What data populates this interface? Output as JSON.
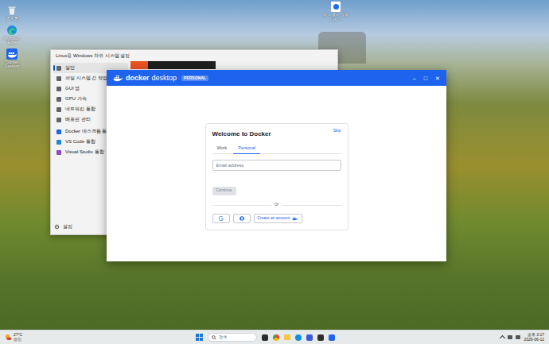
{
  "desktop_icons": [
    {
      "label": "휴지통",
      "kind": "recycle-bin"
    },
    {
      "label": "Microsoft Edge",
      "kind": "edge"
    },
    {
      "label": "Docker Desktop",
      "kind": "docker"
    }
  ],
  "desktop_file": {
    "label": "이 사용자 정보 다시..."
  },
  "wsl_window": {
    "title": "Linux용 Windows 하위 시스템 설정",
    "sidebar": {
      "items": [
        {
          "label": "일반",
          "selected": true,
          "kind": "system"
        },
        {
          "label": "파일 시스템 간 작업",
          "selected": false,
          "kind": "system"
        },
        {
          "label": "GUI 앱",
          "selected": false,
          "kind": "system"
        },
        {
          "label": "GPU 가속",
          "selected": false,
          "kind": "system"
        },
        {
          "label": "네트워킹 통합",
          "selected": false,
          "kind": "system"
        },
        {
          "label": "배포판 관리",
          "selected": false,
          "kind": "system"
        },
        {
          "label": "Docker 데스크톱 통합",
          "selected": false,
          "kind": "docker"
        },
        {
          "label": "VS Code 통합",
          "selected": false,
          "kind": "vscode"
        },
        {
          "label": "Visual Studio 통합",
          "selected": false,
          "kind": "visualstudio"
        }
      ]
    },
    "footer": "설정"
  },
  "docker_window": {
    "brand": "docker",
    "product": "desktop",
    "badge": "PERSONAL",
    "controls": [
      "–",
      "□",
      "✕"
    ],
    "welcome": {
      "title": "Welcome to Docker",
      "skip": "Skip",
      "tabs": [
        {
          "label": "Work",
          "selected": false
        },
        {
          "label": "Personal",
          "selected": true
        }
      ],
      "email": {
        "placeholder": "Email address"
      },
      "continue": {
        "label": "Continue",
        "disabled": true
      },
      "divider": "Or",
      "buttons": [
        {
          "kind": "google"
        },
        {
          "kind": "github"
        },
        {
          "kind": "create",
          "label": "Create an account"
        }
      ]
    }
  },
  "taskbar": {
    "weather": {
      "temp": "27°C",
      "condition": "흐림"
    },
    "search": {
      "placeholder": "검색"
    },
    "clock": {
      "time": "오후 3:17",
      "date": "2026-06-12"
    }
  }
}
